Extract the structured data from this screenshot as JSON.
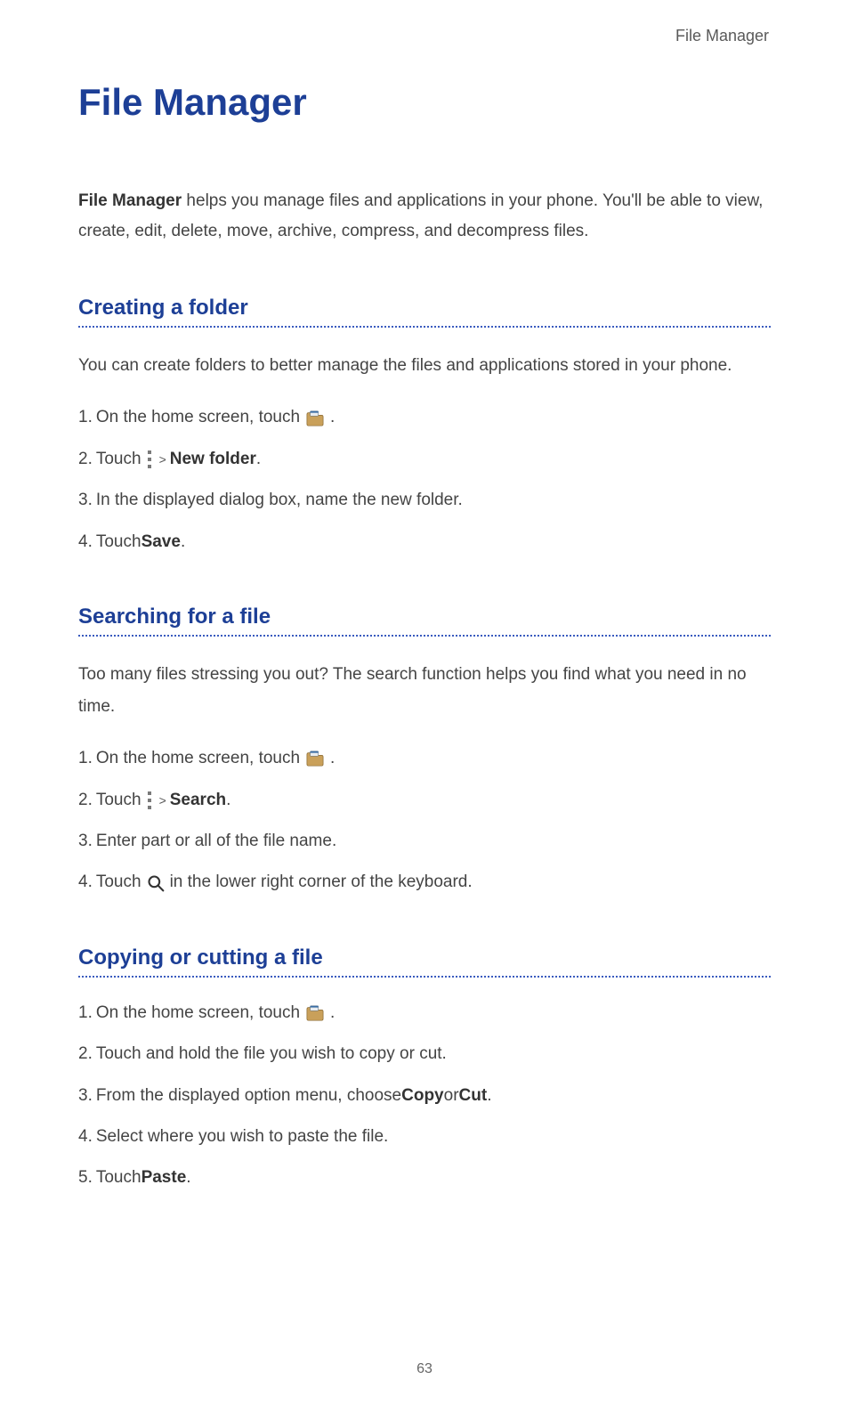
{
  "header": "File Manager",
  "title": "File Manager",
  "intro_bold": "File Manager",
  "intro_rest": " helps you manage files and applications in your phone. You'll be able to view, create, edit, delete, move, archive, compress, and decompress files.",
  "section1": {
    "heading": "Creating a folder",
    "body": "You can create folders to better manage the files and applications stored in your phone.",
    "s1_a": "On the home screen, touch ",
    "s1_b": " .",
    "s2_a": "Touch ",
    "s2_gt": ">",
    "s2_bold": "New folder",
    "s2_end": ".",
    "s3": "In the displayed dialog box, name the new folder.",
    "s4_a": "Touch ",
    "s4_bold": "Save",
    "s4_end": "."
  },
  "section2": {
    "heading": "Searching for a file",
    "body": "Too many files stressing you out? The search function helps you find what you need in no time.",
    "s1_a": "On the home screen, touch ",
    "s1_b": " .",
    "s2_a": "Touch ",
    "s2_gt": ">",
    "s2_bold": "Search",
    "s2_end": ".",
    "s3": "Enter part or all of the file name.",
    "s4_a": "Touch ",
    "s4_b": " in the lower right corner of the keyboard."
  },
  "section3": {
    "heading": "Copying or cutting a file",
    "s1_a": "On the home screen, touch ",
    "s1_b": " .",
    "s2": "Touch and hold the file you wish to copy or cut.",
    "s3_a": "From the displayed option menu, choose ",
    "s3_b1": "Copy",
    "s3_mid": " or ",
    "s3_b2": "Cut",
    "s3_end": ".",
    "s4": "Select where you wish to paste the file.",
    "s5_a": "Touch ",
    "s5_bold": "Paste",
    "s5_end": "."
  },
  "nums": {
    "n1": "1.",
    "n2": "2.",
    "n3": "3.",
    "n4": "4.",
    "n5": "5."
  },
  "pagenum": "63"
}
